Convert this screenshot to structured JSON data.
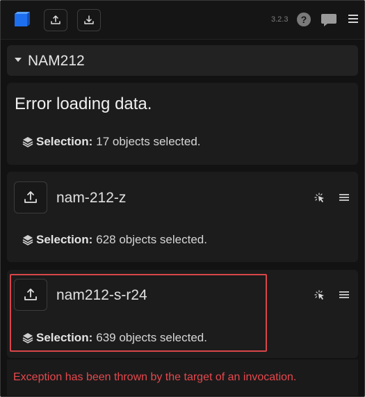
{
  "toolbar": {
    "version": "3.2.3",
    "help_symbol": "?",
    "icons": {
      "logo": "blue-cube-logo",
      "upload": "upload-icon",
      "download": "download-icon",
      "help": "help-icon",
      "chat": "chat-icon",
      "menu": "hamburger-menu-icon"
    }
  },
  "group": {
    "title": "NAM212",
    "expanded": true
  },
  "cards": [
    {
      "error": "Error loading data.",
      "selection_label": "Selection:",
      "selection_text": "17 objects selected."
    },
    {
      "name": "nam-212-z",
      "selection_label": "Selection:",
      "selection_text": "628 objects selected."
    },
    {
      "name": "nam212-s-r24",
      "selection_label": "Selection:",
      "selection_text": "639 objects selected.",
      "highlighted": true
    }
  ],
  "footer": {
    "exception": "Exception has been thrown by the target of an invocation."
  },
  "colors": {
    "background": "#121212",
    "card": "#1c1c1c",
    "accent_blue": "#1e6ff0",
    "error_red": "#e5484d",
    "highlight_red": "#d9464a"
  }
}
